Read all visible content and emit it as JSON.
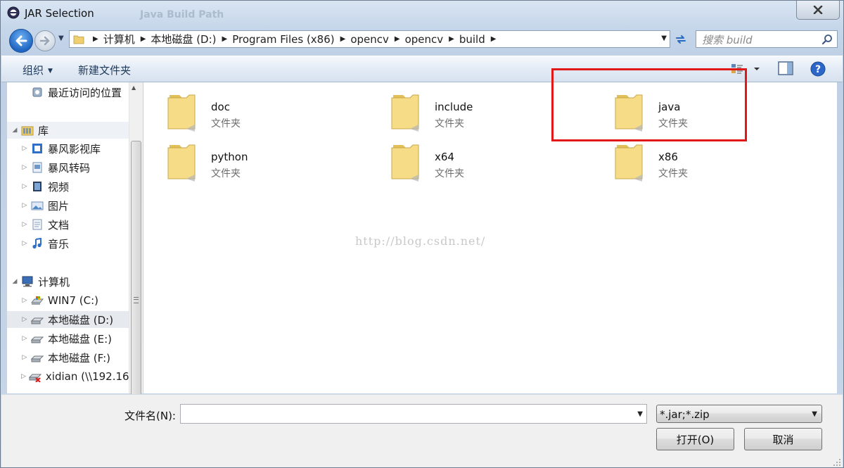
{
  "window": {
    "title": "JAR Selection",
    "ghost_title": "Java Build Path"
  },
  "nav": {
    "breadcrumbs": [
      "计算机",
      "本地磁盘 (D:)",
      "Program Files (x86)",
      "opencv",
      "opencv",
      "build"
    ],
    "search_placeholder": "搜索 build"
  },
  "toolbar": {
    "organize_label": "组织",
    "new_folder_label": "新建文件夹"
  },
  "sidebar": {
    "recent": {
      "label": "最近访问的位置"
    },
    "libraries": {
      "label": "库",
      "items": [
        {
          "label": "暴风影视库"
        },
        {
          "label": "暴风转码"
        },
        {
          "label": "视频"
        },
        {
          "label": "图片"
        },
        {
          "label": "文档"
        },
        {
          "label": "音乐"
        }
      ]
    },
    "computer": {
      "label": "计算机",
      "items": [
        {
          "label": "WIN7 (C:)"
        },
        {
          "label": "本地磁盘 (D:)",
          "selected": true
        },
        {
          "label": "本地磁盘 (E:)"
        },
        {
          "label": "本地磁盘 (F:)"
        },
        {
          "label": "xidian (\\\\192.16"
        }
      ]
    }
  },
  "content": {
    "items": [
      {
        "name": "doc",
        "type": "文件夹"
      },
      {
        "name": "include",
        "type": "文件夹"
      },
      {
        "name": "java",
        "type": "文件夹"
      },
      {
        "name": "python",
        "type": "文件夹"
      },
      {
        "name": "x64",
        "type": "文件夹"
      },
      {
        "name": "x86",
        "type": "文件夹"
      }
    ],
    "watermark": "http://blog.csdn.net/"
  },
  "footer": {
    "filename_label": "文件名(N):",
    "filename_value": "",
    "filetype_value": "*.jar;*.zip",
    "open_label": "打开(O)",
    "cancel_label": "取消"
  },
  "colors": {
    "highlight": "#e01818",
    "folder": "#f3d77a"
  }
}
